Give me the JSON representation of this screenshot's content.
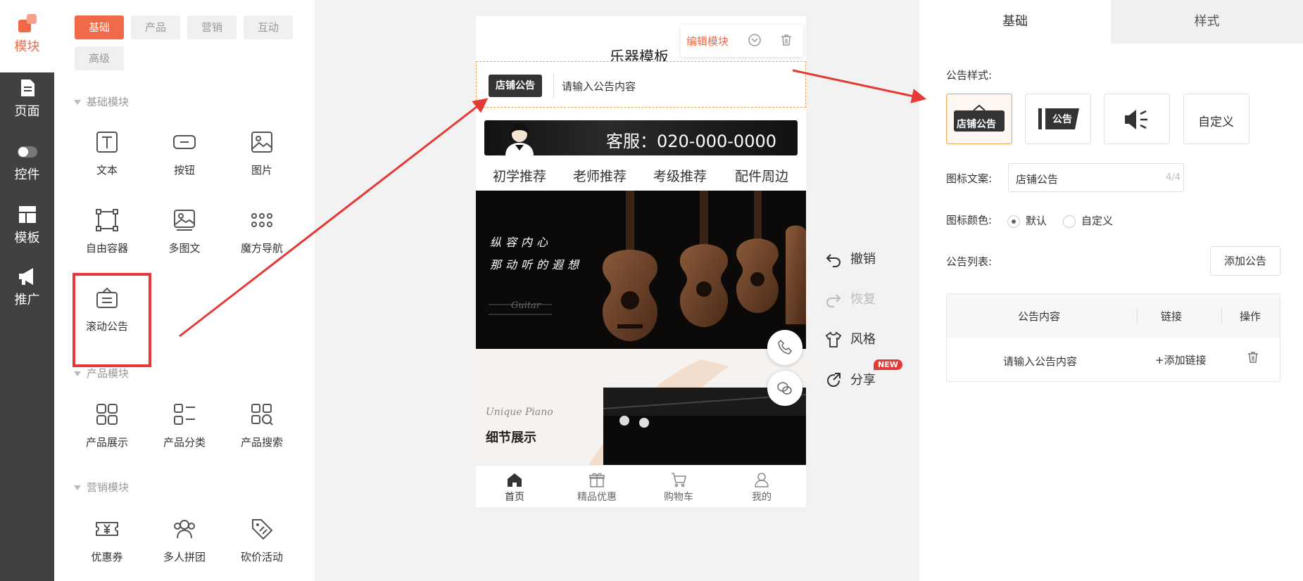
{
  "nav": {
    "items": [
      {
        "label": "模块",
        "icon": "module-icon",
        "active": true
      },
      {
        "label": "页面",
        "icon": "page-icon"
      },
      {
        "label": "控件",
        "icon": "toggle-icon"
      },
      {
        "label": "模板",
        "icon": "template-icon"
      },
      {
        "label": "推广",
        "icon": "megaphone-icon"
      }
    ]
  },
  "modules": {
    "tabs": [
      "基础",
      "产品",
      "营销",
      "互动",
      "高级"
    ],
    "sections": [
      {
        "title": "基础模块",
        "items": [
          "文本",
          "按钮",
          "图片",
          "自由容器",
          "多图文",
          "魔方导航",
          "滚动公告"
        ]
      },
      {
        "title": "产品模块",
        "items": [
          "产品展示",
          "产品分类",
          "产品搜索"
        ]
      },
      {
        "title": "营销模块",
        "items": [
          "优惠券",
          "多人拼团",
          "砍价活动"
        ]
      }
    ]
  },
  "canvas": {
    "title": "乐器模板",
    "edit_label": "编辑模块",
    "notice_badge": "店铺公告",
    "notice_text": "请输入公告内容",
    "service": "客服：020-000-0000",
    "categories": [
      "初学推荐",
      "老师推荐",
      "考级推荐",
      "配件周边"
    ],
    "banner_line1": "纵容内心",
    "banner_line2": "那动听的遐想",
    "banner_script": "Guitar",
    "detail_script": "Unique Piano",
    "detail_title": "细节展示",
    "tabbar": [
      "首页",
      "精品优惠",
      "购物车",
      "我的"
    ]
  },
  "tools": {
    "undo": "撤销",
    "redo": "恢复",
    "style": "风格",
    "share": "分享",
    "new_badge": "NEW"
  },
  "panel": {
    "tabs": [
      "基础",
      "样式"
    ],
    "notice_style_label": "公告样式:",
    "styles": [
      "店铺公告",
      "公告",
      "",
      "自定义"
    ],
    "icon_text_label": "图标文案:",
    "icon_text_value": "店铺公告",
    "icon_text_count": "4/4",
    "icon_color_label": "图标颜色:",
    "color_default": "默认",
    "color_custom": "自定义",
    "list_label": "公告列表:",
    "add_button": "添加公告",
    "table": {
      "headers": [
        "公告内容",
        "链接",
        "操作"
      ],
      "row": {
        "content": "请输入公告内容",
        "link": "+添加链接"
      }
    }
  },
  "colors": {
    "accent": "#f06a4a",
    "nav_bg": "#414141",
    "highlight": "#e53935"
  }
}
